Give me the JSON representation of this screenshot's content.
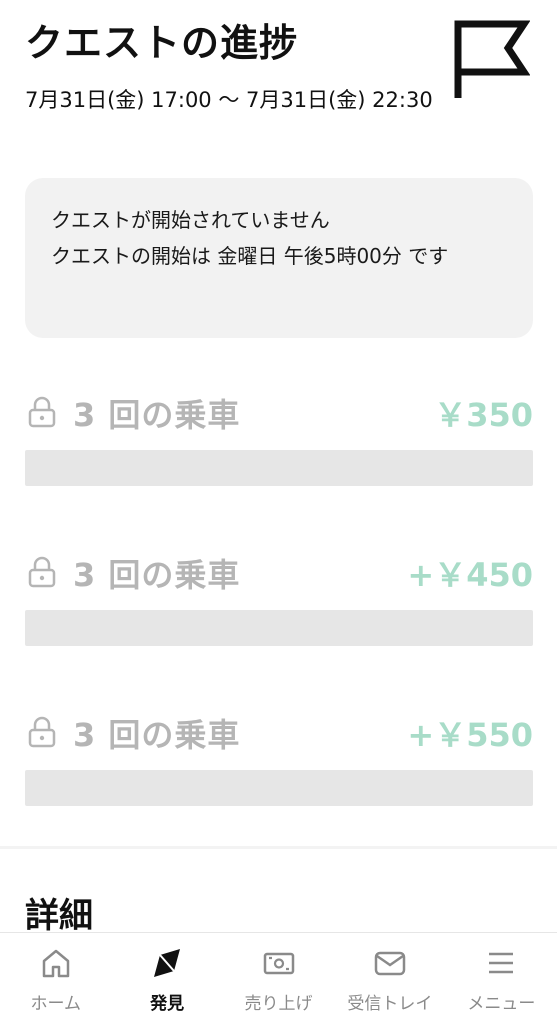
{
  "header": {
    "title": "クエストの進捗",
    "datetime": "7月31日(金) 17:00 ～ 7月31日(金) 22:30"
  },
  "notice": {
    "line1": "クエストが開始されていません",
    "line2": "クエストの開始は 金曜日 午後5時00分 です"
  },
  "quests": [
    {
      "name": "3 回の乗車",
      "reward": "￥350",
      "progress": 0
    },
    {
      "name": "3 回の乗車",
      "reward": "+￥450",
      "progress": 0
    },
    {
      "name": "3 回の乗車",
      "reward": "+￥550",
      "progress": 0
    }
  ],
  "details": {
    "title": "詳細"
  },
  "nav": {
    "items": [
      {
        "label": "ホーム",
        "icon": "home-icon"
      },
      {
        "label": "発見",
        "icon": "compass-icon",
        "active": true
      },
      {
        "label": "売り上げ",
        "icon": "wallet-icon"
      },
      {
        "label": "受信トレイ",
        "icon": "mail-icon"
      },
      {
        "label": "メニュー",
        "icon": "menu-icon"
      }
    ]
  },
  "colors": {
    "reward": "#a8dcc8",
    "locked_text": "#b5b5b5",
    "bar": "#e6e6e6",
    "notice_bg": "#f2f2f2"
  }
}
